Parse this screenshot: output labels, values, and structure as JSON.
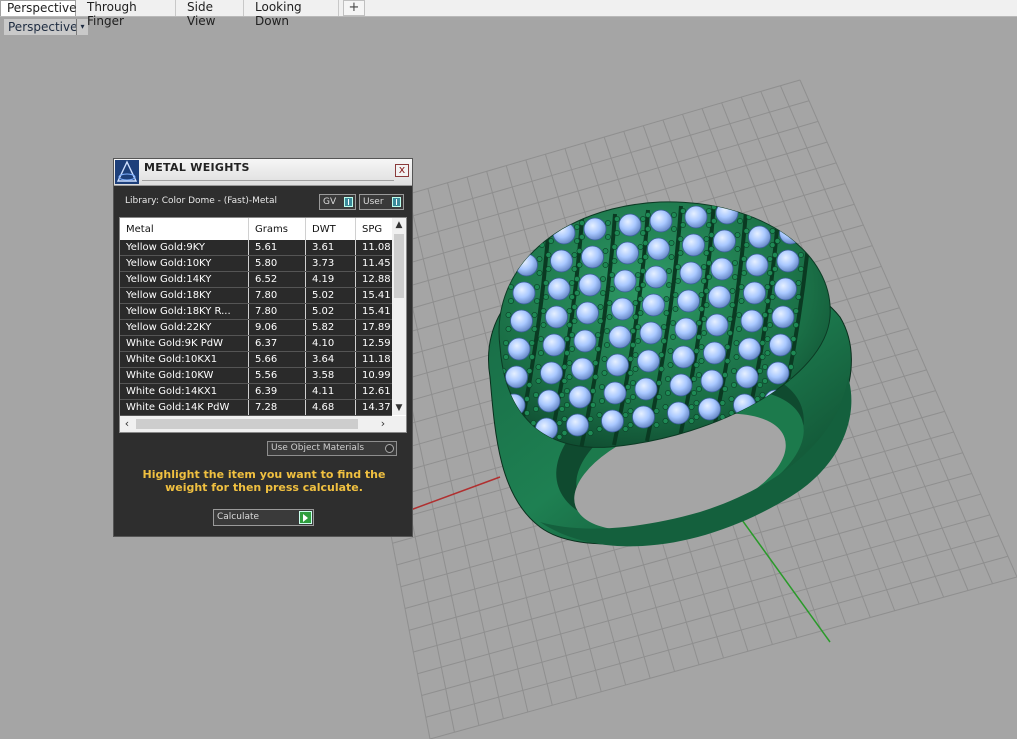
{
  "tabs": [
    "Perspective",
    "Through Finger",
    "Side View",
    "Looking Down"
  ],
  "add_tab_glyph": "+",
  "viewport": {
    "label": "Perspective",
    "menu_glyph": "▾"
  },
  "dialog": {
    "title": "METAL WEIGHTS",
    "close_glyph": "x",
    "library": "Library: Color Dome - (Fast)-Metal",
    "gv_label": "GV",
    "user_label": "User",
    "columns": [
      "Metal",
      "Grams",
      "DWT",
      "SPG"
    ],
    "rows": [
      [
        "Yellow Gold:9KY",
        "5.61",
        "3.61",
        "11.08"
      ],
      [
        "Yellow Gold:10KY",
        "5.80",
        "3.73",
        "11.45"
      ],
      [
        "Yellow Gold:14KY",
        "6.52",
        "4.19",
        "12.88"
      ],
      [
        "Yellow Gold:18KY",
        "7.80",
        "5.02",
        "15.41"
      ],
      [
        "Yellow Gold:18KY R...",
        "7.80",
        "5.02",
        "15.41"
      ],
      [
        "Yellow Gold:22KY",
        "9.06",
        "5.82",
        "17.89"
      ],
      [
        "White Gold:9K PdW",
        "6.37",
        "4.10",
        "12.59"
      ],
      [
        "White Gold:10KX1",
        "5.66",
        "3.64",
        "11.18"
      ],
      [
        "White Gold:10KW",
        "5.56",
        "3.58",
        "10.99"
      ],
      [
        "White Gold:14KX1",
        "6.39",
        "4.11",
        "12.61"
      ],
      [
        "White Gold:14K PdW",
        "7.28",
        "4.68",
        "14.37"
      ]
    ],
    "use_object_materials": "Use Object Materials",
    "hint": "Highlight the item you want to find the weight for then press calculate.",
    "calculate_label": "Calculate"
  },
  "colors": {
    "viewport_bg": "#a5a5a5",
    "ring_green": "#1f7a4f",
    "gem_blue": "#a9c8ff",
    "hint_yellow": "#f0c040"
  }
}
